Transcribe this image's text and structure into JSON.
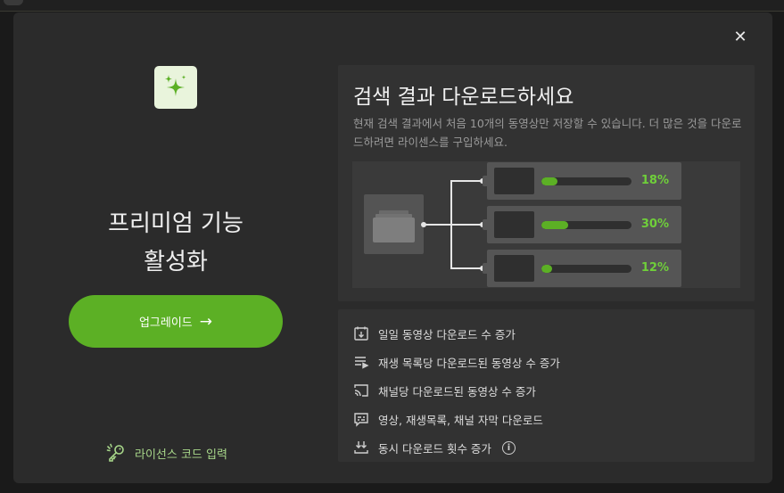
{
  "modal": {
    "close_glyph": "✕",
    "title_line1": "프리미엄 기능",
    "title_line2": "활성화",
    "upgrade_label": "업그레이드",
    "upgrade_arrow": "→",
    "license_link": "라이선스 코드 입력"
  },
  "preview": {
    "title": "검색 결과 다운로드하세요",
    "description": "현재 검색 결과에서 처음 10개의 동영상만 저장할 수 있습니다. 더 많은 것을 다운로드하려면 라이센스를 구입하세요.",
    "downloads": [
      {
        "percent_label": "18%",
        "progress": 0.18
      },
      {
        "percent_label": "30%",
        "progress": 0.3
      },
      {
        "percent_label": "12%",
        "progress": 0.12
      }
    ]
  },
  "features": [
    {
      "label": "일일 동영상 다운로드 수 증가",
      "icon": "calendar-download-icon"
    },
    {
      "label": "재생 목록당 다운로드된 동영상 수 증가",
      "icon": "playlist-icon"
    },
    {
      "label": "채널당 다운로드된 동영상 수 증가",
      "icon": "cast-channel-icon"
    },
    {
      "label": "영상, 재생목록, 채널 자막 다운로드",
      "icon": "subtitles-icon"
    },
    {
      "label": "동시 다운로드 횟수 증가",
      "icon": "multi-download-icon",
      "has_info": true
    }
  ],
  "colors": {
    "accent": "#5cb025",
    "percent_text": "#6fcf3a",
    "link_text": "#a8d78a",
    "modal_bg": "#2b2b2b",
    "card_bg": "#323232"
  }
}
